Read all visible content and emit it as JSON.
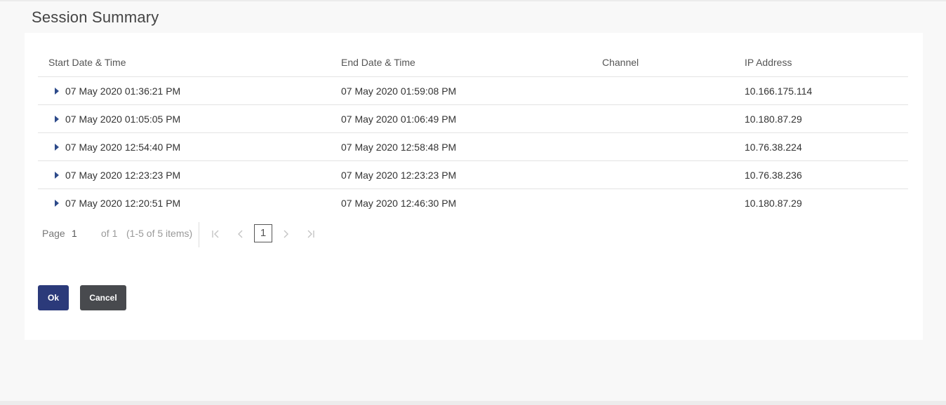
{
  "page": {
    "title": "Session Summary"
  },
  "table": {
    "columns": [
      "Start Date & Time",
      "End Date & Time",
      "Channel",
      "IP Address"
    ],
    "rows": [
      {
        "start": "07 May 2020 01:36:21 PM",
        "end": "07 May 2020 01:59:08 PM",
        "channel": "",
        "ip": "10.166.175.114"
      },
      {
        "start": "07 May 2020 01:05:05 PM",
        "end": "07 May 2020 01:06:49 PM",
        "channel": "",
        "ip": "10.180.87.29"
      },
      {
        "start": "07 May 2020 12:54:40 PM",
        "end": "07 May 2020 12:58:48 PM",
        "channel": "",
        "ip": "10.76.38.224"
      },
      {
        "start": "07 May 2020 12:23:23 PM",
        "end": "07 May 2020 12:23:23 PM",
        "channel": "",
        "ip": "10.76.38.236"
      },
      {
        "start": "07 May 2020 12:20:51 PM",
        "end": "07 May 2020 12:46:30 PM",
        "channel": "",
        "ip": "10.180.87.29"
      }
    ]
  },
  "pager": {
    "page_label": "Page",
    "current_page": "1",
    "of_label": "of 1",
    "items_label": "(1-5 of 5 items)",
    "page_number": "1",
    "icons": {
      "first": "first-page-icon",
      "prev": "previous-page-icon",
      "next": "next-page-icon",
      "last": "last-page-icon"
    }
  },
  "actions": {
    "ok_label": "Ok",
    "cancel_label": "Cancel"
  },
  "colors": {
    "ok_button": "#2b3a7a",
    "cancel_button": "#484a4e",
    "expand_caret": "#2d4a8a"
  }
}
